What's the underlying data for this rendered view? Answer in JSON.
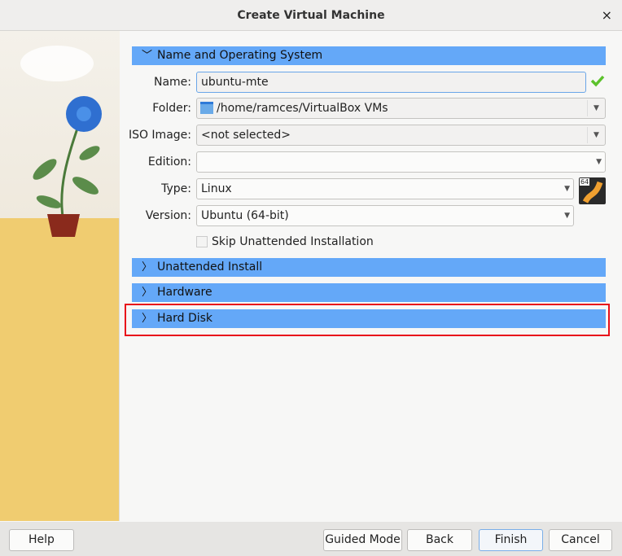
{
  "window": {
    "title": "Create Virtual Machine",
    "close_icon": "×"
  },
  "sections": {
    "name_os": "Name and Operating System",
    "unattended": "Unattended Install",
    "hardware": "Hardware",
    "hard_disk": "Hard Disk"
  },
  "form": {
    "name_label": "Name:",
    "name_value": "ubuntu-mte",
    "folder_label": "Folder:",
    "folder_value": "/home/ramces/VirtualBox VMs",
    "iso_label": "ISO Image:",
    "iso_value": "<not selected>",
    "edition_label": "Edition:",
    "edition_value": "",
    "type_label": "Type:",
    "type_value": "Linux",
    "version_label": "Version:",
    "version_value": "Ubuntu (64-bit)",
    "skip_label": "Skip Unattended Installation",
    "skip_checked": false,
    "os_badge": "64"
  },
  "buttons": {
    "help": "Help",
    "guided": "Guided Mode",
    "back": "Back",
    "finish": "Finish",
    "cancel": "Cancel"
  },
  "colors": {
    "section": "#64a8f8",
    "highlight": "#e8101a",
    "valid": "#5cc22c"
  }
}
